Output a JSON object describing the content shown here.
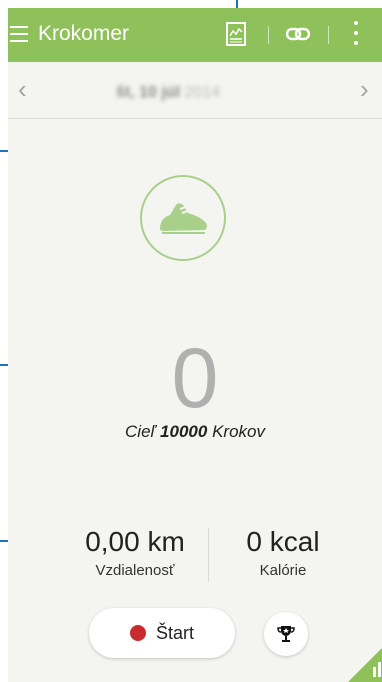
{
  "app": {
    "title": "Krokomer"
  },
  "date": {
    "day": "št, 10 júl",
    "year": "2014"
  },
  "steps": {
    "count": "0",
    "goal_prefix": "Cieľ",
    "goal_value": "10000",
    "goal_suffix": "Krokov"
  },
  "stats": {
    "distance_value": "0,00 km",
    "distance_label": "Vzdialenosť",
    "calories_value": "0 kcal",
    "calories_label": "Kalórie"
  },
  "buttons": {
    "start_label": "Štart"
  },
  "icons": {
    "menu": "hamburger-icon",
    "chart": "chart-icon",
    "link": "link-icon",
    "more": "more-vert-icon",
    "prev": "chevron-left-icon",
    "next": "chevron-right-icon",
    "shoe": "shoe-icon",
    "record": "record-dot-icon",
    "trophy": "trophy-icon",
    "bars": "bar-chart-icon"
  },
  "colors": {
    "accent_green": "#8fc15a",
    "callout_blue": "#1b76b9",
    "record_red": "#c82a2e"
  }
}
